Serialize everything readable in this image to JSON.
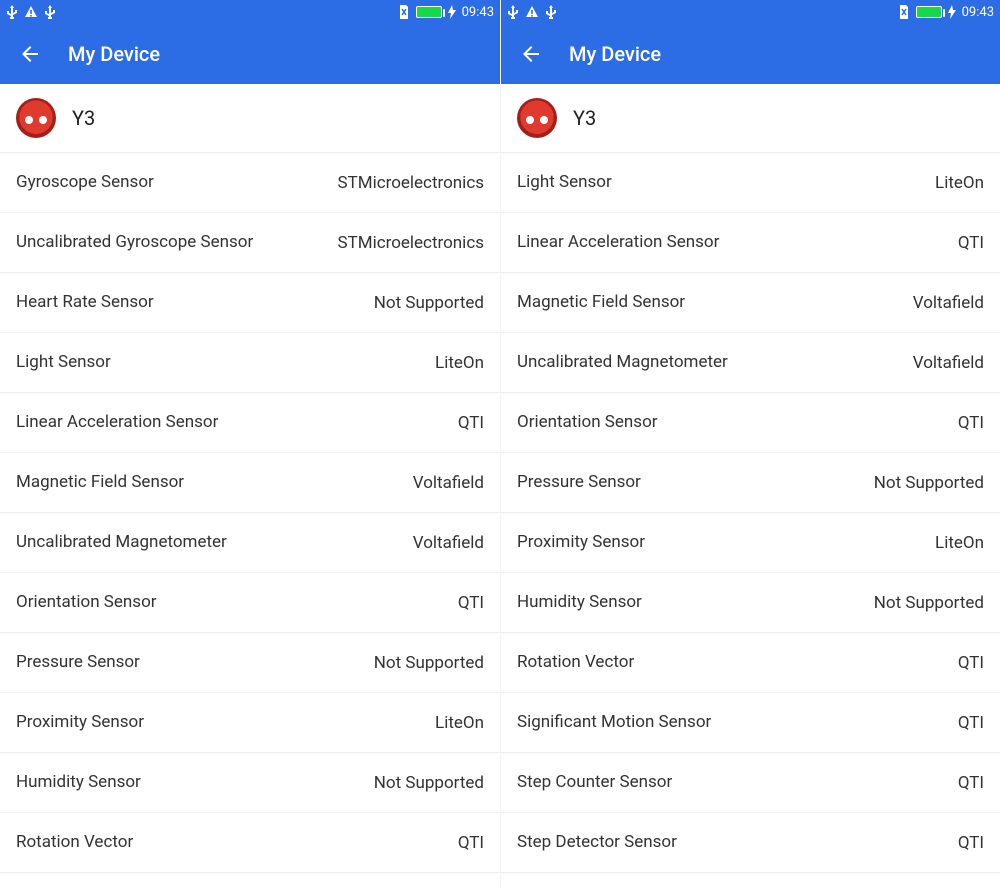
{
  "status": {
    "time": "09:43"
  },
  "appbar": {
    "title": "My Device"
  },
  "device": {
    "name": "Y3"
  },
  "left": {
    "rows": [
      {
        "label": "Gyroscope Sensor",
        "value": "STMicroelectronics"
      },
      {
        "label": "Uncalibrated Gyroscope Sensor",
        "value": "STMicroelectronics"
      },
      {
        "label": "Heart Rate Sensor",
        "value": "Not Supported"
      },
      {
        "label": "Light Sensor",
        "value": "LiteOn"
      },
      {
        "label": "Linear Acceleration Sensor",
        "value": "QTI"
      },
      {
        "label": "Magnetic Field Sensor",
        "value": "Voltafield"
      },
      {
        "label": "Uncalibrated Magnetometer",
        "value": "Voltafield"
      },
      {
        "label": "Orientation Sensor",
        "value": "QTI"
      },
      {
        "label": "Pressure Sensor",
        "value": "Not Supported"
      },
      {
        "label": "Proximity Sensor",
        "value": "LiteOn"
      },
      {
        "label": "Humidity Sensor",
        "value": "Not Supported"
      },
      {
        "label": "Rotation Vector",
        "value": "QTI"
      }
    ]
  },
  "right": {
    "rows": [
      {
        "label": "Light Sensor",
        "value": "LiteOn"
      },
      {
        "label": "Linear Acceleration Sensor",
        "value": "QTI"
      },
      {
        "label": "Magnetic Field Sensor",
        "value": "Voltafield"
      },
      {
        "label": "Uncalibrated Magnetometer",
        "value": "Voltafield"
      },
      {
        "label": "Orientation Sensor",
        "value": "QTI"
      },
      {
        "label": "Pressure Sensor",
        "value": "Not Supported"
      },
      {
        "label": "Proximity Sensor",
        "value": "LiteOn"
      },
      {
        "label": "Humidity Sensor",
        "value": "Not Supported"
      },
      {
        "label": "Rotation Vector",
        "value": "QTI"
      },
      {
        "label": "Significant Motion Sensor",
        "value": "QTI"
      },
      {
        "label": "Step Counter Sensor",
        "value": "QTI"
      },
      {
        "label": "Step Detector Sensor",
        "value": "QTI"
      }
    ]
  }
}
